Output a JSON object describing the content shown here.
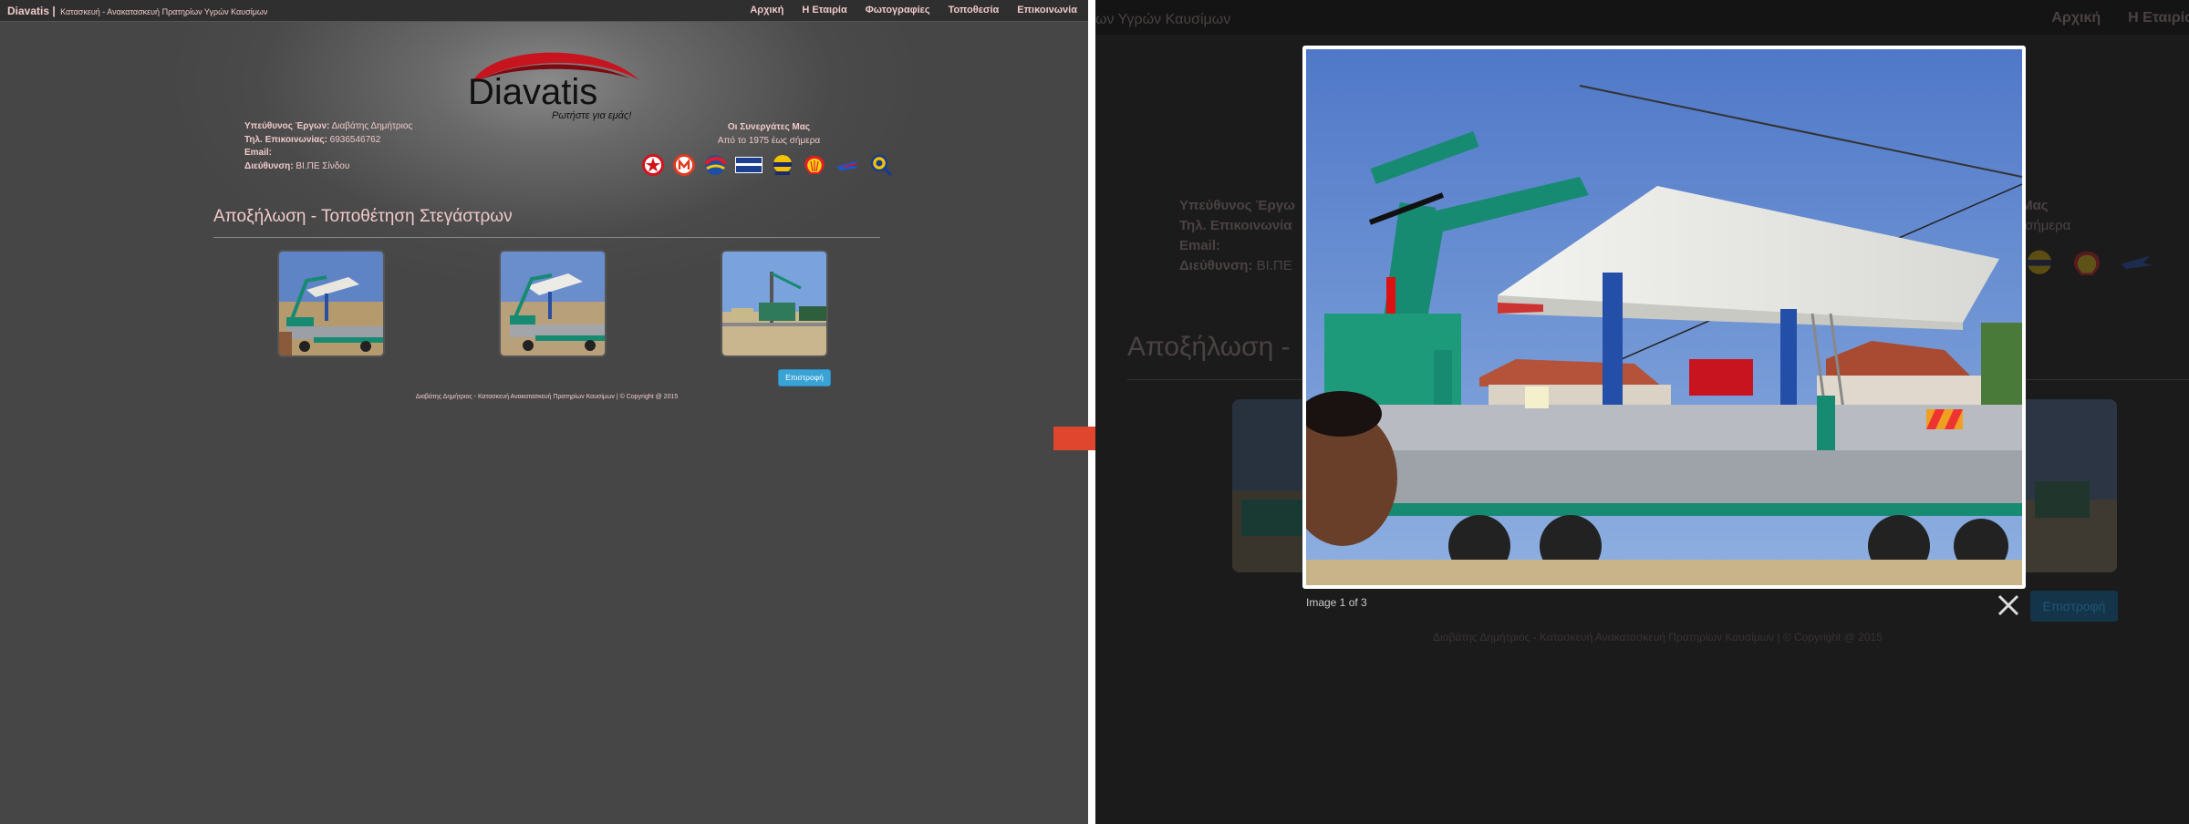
{
  "site": {
    "brand_name": "Diavatis",
    "brand_separator": "|",
    "brand_tagline": "Κατασκευή - Ανακατασκευή Πρατηρίων Υγρών Καυσίμων",
    "nav": [
      "Αρχική",
      "Η Εταιρία",
      "Φωτογραφίες",
      "Τοποθεσία",
      "Επικοινωνία"
    ],
    "logo_text": "Diavatis",
    "logo_slogan": "Ρωτήστε για εμάς!",
    "contact": {
      "manager_label": "Υπεύθυνος Έργων:",
      "manager_value": "Διαβάτης Δημήτριος",
      "phone_label": "Τηλ. Επικοινωνίας:",
      "phone_value": "6936546762",
      "email_label": "Email:",
      "address_label": "Διεύθυνση:",
      "address_value": "ΒΙ.ΠΕ Σίνδου"
    },
    "partners_title": "Οι Συνεργάτες Μας",
    "partners_subtitle": "Από το 1975 έως σήμερα",
    "partner_icons": [
      "texaco-icon",
      "revoil-icon",
      "eko-icon",
      "aegean-icon",
      "cyclon-icon",
      "shell-icon",
      "jetoil-icon",
      "elin-icon"
    ],
    "page_title": "Αποξήλωση - Τοποθέτηση Στεγάστρων",
    "back_button": "Επιστροφή",
    "footer": "Διαβάτης Δημήτριος - Κατασκευή Ανακατασκευή Πρατηρίων Καυσίμων | © Copyright @ 2015"
  },
  "right": {
    "brand_tagline_partial": "ων Υγρών Καυσίμων",
    "nav_partial": [
      "Αρχική",
      "Η Εταιρία"
    ],
    "manager_label_partial": "Υπεύθυνος Έργω",
    "phone_label_partial": "Τηλ. Επικοινωνία",
    "email_label": "Email:",
    "address_label_partial": "Διεύθυνση:",
    "address_value_partial": "ΒΙ.ΠΕ",
    "partners_title_partial": "ες Μας",
    "partners_subtitle_partial": "ως σήμερα",
    "page_title_partial": "Αποξήλωση -",
    "footer": "Διαβάτης Δημήτριος - Κατασκευή Ανακατασκευή Πρατηρίων Καυσίμων | © Copyright @ 2015"
  },
  "lightbox": {
    "caption": "Image 1 of 3",
    "close_icon": "close-icon"
  },
  "colors": {
    "page_bg": "#464646",
    "text_pink": "#f0c9c9",
    "button_blue": "#3aa3d6",
    "arrow_red": "#e0452d",
    "logo_red": "#c8141e"
  }
}
